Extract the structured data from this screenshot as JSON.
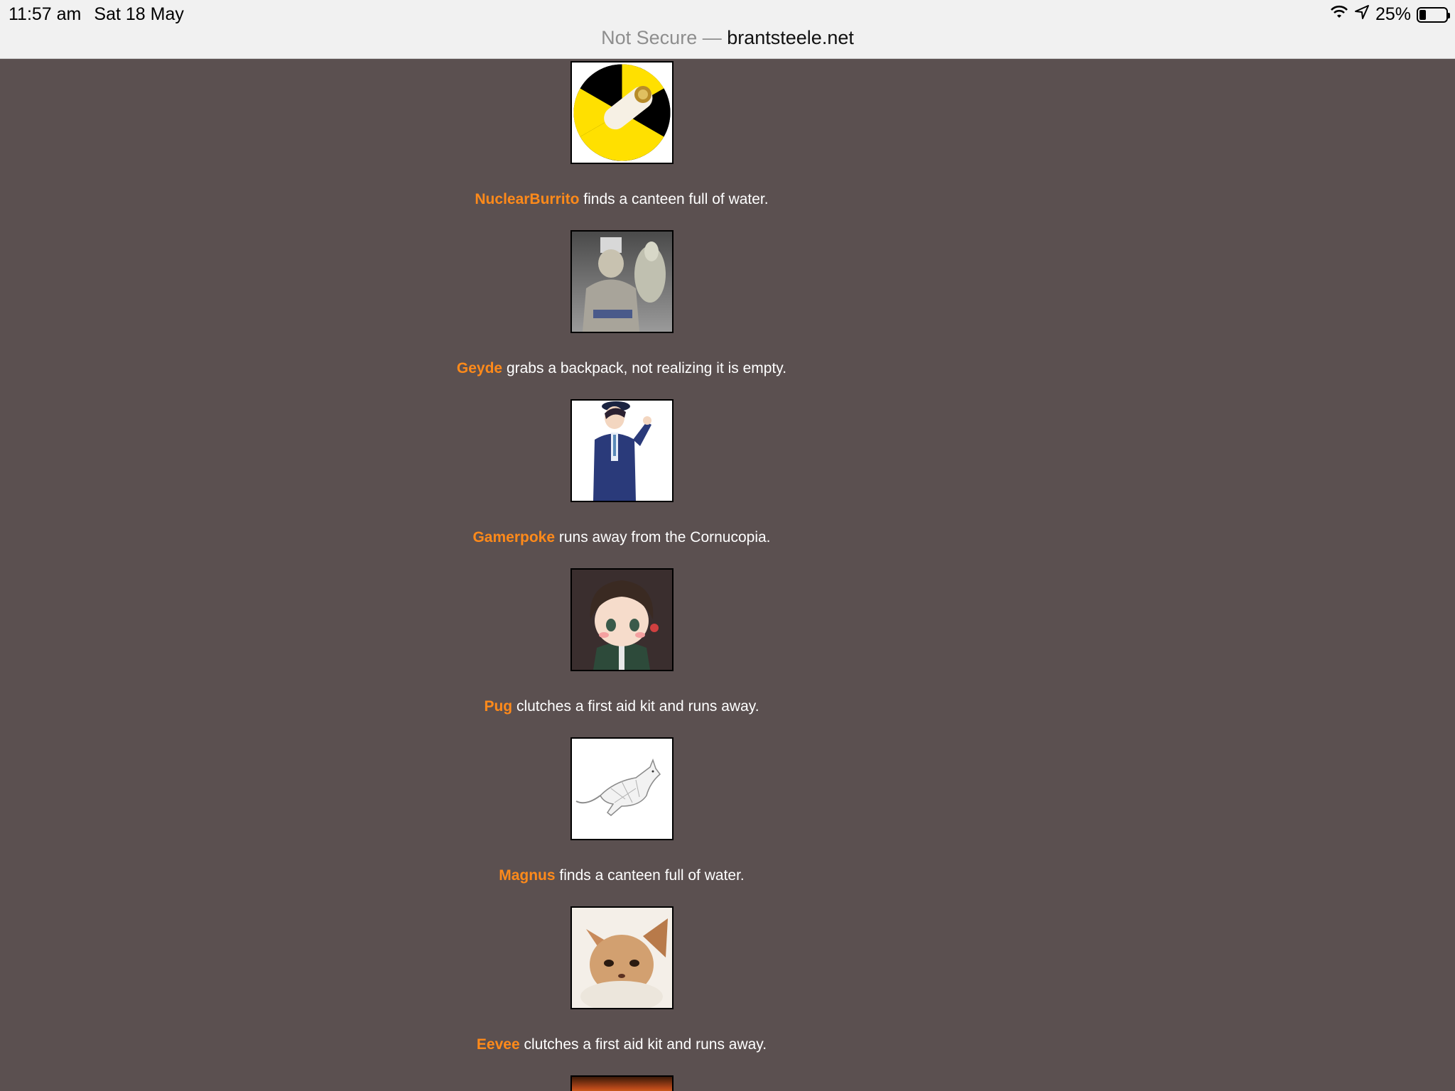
{
  "status_bar": {
    "time": "11:57 am",
    "date": "Sat 18 May",
    "battery_percent": "25%",
    "battery_level": 0.25,
    "icons": [
      "wifi-icon",
      "location-arrow-icon",
      "battery-icon"
    ]
  },
  "url_bar": {
    "security_label": "Not Secure —",
    "domain": "brantsteele.net"
  },
  "colors": {
    "page_background": "#5b5050",
    "tribute_name": "#ff8a1a",
    "text": "#ffffff"
  },
  "events": [
    {
      "avatar": "nuclear-burrito-avatar",
      "name": "NuclearBurrito",
      "action": "finds a canteen full of water."
    },
    {
      "avatar": "geyde-avatar",
      "name": "Geyde",
      "action": "grabs a backpack, not realizing it is empty."
    },
    {
      "avatar": "gamerpoke-avatar",
      "name": "Gamerpoke",
      "action": "runs away from the Cornucopia."
    },
    {
      "avatar": "pug-avatar",
      "name": "Pug",
      "action": "clutches a first aid kit and runs away."
    },
    {
      "avatar": "magnus-avatar",
      "name": "Magnus",
      "action": "finds a canteen full of water."
    },
    {
      "avatar": "eevee-avatar",
      "name": "Eevee",
      "action": "clutches a first aid kit and runs away."
    }
  ]
}
